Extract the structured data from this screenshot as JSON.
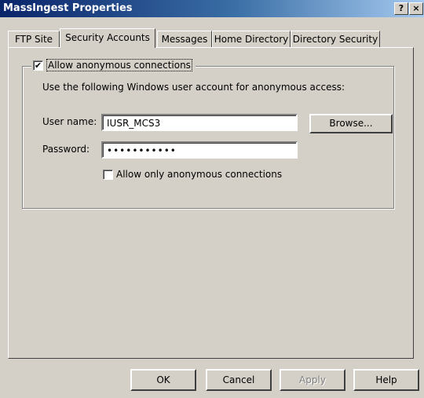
{
  "window": {
    "title": "MassIngest Properties",
    "help_glyph": "?",
    "close_glyph": "×"
  },
  "tabs": [
    {
      "label": "FTP Site",
      "active": false
    },
    {
      "label": "Security Accounts",
      "active": true
    },
    {
      "label": "Messages",
      "active": false
    },
    {
      "label": "Home Directory",
      "active": false
    },
    {
      "label": "Directory Security",
      "active": false
    }
  ],
  "anonymous_group": {
    "checkbox_label": "Allow anonymous connections",
    "checkbox_checked": true,
    "description": "Use the following Windows user account for anonymous access:",
    "username_label": "User name:",
    "username_value": "IUSR_MCS3",
    "browse_label": "Browse...",
    "password_label": "Password:",
    "password_value": "•••••••••••",
    "only_anon_label": "Allow only anonymous connections",
    "only_anon_checked": false
  },
  "footer": {
    "ok": "OK",
    "cancel": "Cancel",
    "apply": "Apply",
    "help": "Help"
  }
}
